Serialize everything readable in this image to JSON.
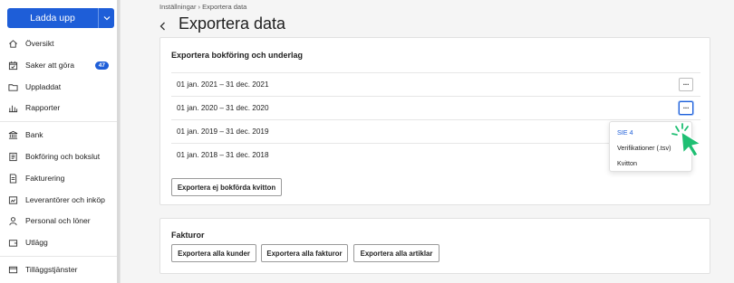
{
  "sidebar": {
    "upload_label": "Ladda upp",
    "items": [
      {
        "label": "Översikt",
        "icon": "home-icon"
      },
      {
        "label": "Saker att göra",
        "icon": "calendar-icon",
        "badge": "47"
      },
      {
        "label": "Uppladdat",
        "icon": "folder-icon"
      },
      {
        "label": "Rapporter",
        "icon": "chart-icon"
      },
      {
        "label": "Bank",
        "icon": "bank-icon"
      },
      {
        "label": "Bokföring och bokslut",
        "icon": "book-icon"
      },
      {
        "label": "Fakturering",
        "icon": "invoice-icon"
      },
      {
        "label": "Leverantörer och inköp",
        "icon": "supplier-icon"
      },
      {
        "label": "Personal och löner",
        "icon": "person-icon"
      },
      {
        "label": "Utlägg",
        "icon": "wallet-icon"
      },
      {
        "label": "Tilläggstjänster",
        "icon": "addon-icon"
      }
    ]
  },
  "breadcrumb": {
    "parent": "Inställningar",
    "separator": "›",
    "current": "Exportera data"
  },
  "page": {
    "title": "Exportera data"
  },
  "export_section": {
    "title": "Exportera bokföring och underlag",
    "periods": [
      "01 jan. 2021 – 31 dec. 2021",
      "01 jan. 2020 – 31 dec. 2020",
      "01 jan. 2019 – 31 dec. 2019",
      "01 jan. 2018 – 31 dec. 2018"
    ],
    "more_label": "···",
    "export_receipts_label": "Exportera ej bokförda kvitton",
    "menu": [
      "SIE 4",
      "Verifikationer (.tsv)",
      "Kvitton"
    ]
  },
  "invoices_section": {
    "title": "Fakturor",
    "buttons": [
      "Exportera alla kunder",
      "Exportera alla fakturor",
      "Exportera alla artiklar"
    ]
  },
  "colors": {
    "accent": "#1e5ed8",
    "cursor": "#1fbf73"
  }
}
